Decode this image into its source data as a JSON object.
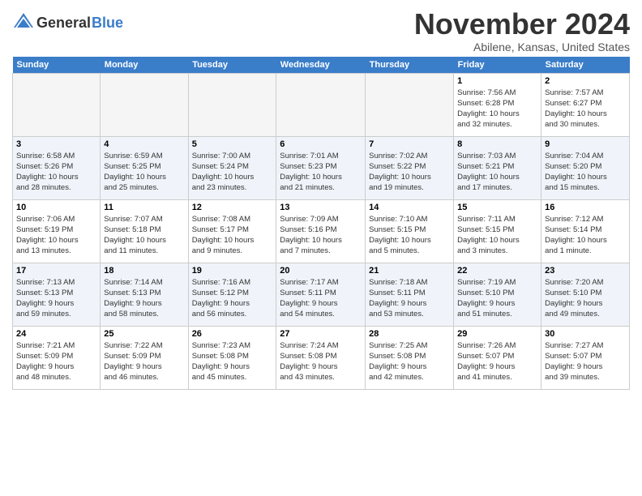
{
  "header": {
    "logo_line1": "General",
    "logo_line2": "Blue",
    "month_title": "November 2024",
    "location": "Abilene, Kansas, United States"
  },
  "calendar": {
    "weekdays": [
      "Sunday",
      "Monday",
      "Tuesday",
      "Wednesday",
      "Thursday",
      "Friday",
      "Saturday"
    ],
    "weeks": [
      [
        {
          "day": "",
          "info": ""
        },
        {
          "day": "",
          "info": ""
        },
        {
          "day": "",
          "info": ""
        },
        {
          "day": "",
          "info": ""
        },
        {
          "day": "",
          "info": ""
        },
        {
          "day": "1",
          "info": "Sunrise: 7:56 AM\nSunset: 6:28 PM\nDaylight: 10 hours\nand 32 minutes."
        },
        {
          "day": "2",
          "info": "Sunrise: 7:57 AM\nSunset: 6:27 PM\nDaylight: 10 hours\nand 30 minutes."
        }
      ],
      [
        {
          "day": "3",
          "info": "Sunrise: 6:58 AM\nSunset: 5:26 PM\nDaylight: 10 hours\nand 28 minutes."
        },
        {
          "day": "4",
          "info": "Sunrise: 6:59 AM\nSunset: 5:25 PM\nDaylight: 10 hours\nand 25 minutes."
        },
        {
          "day": "5",
          "info": "Sunrise: 7:00 AM\nSunset: 5:24 PM\nDaylight: 10 hours\nand 23 minutes."
        },
        {
          "day": "6",
          "info": "Sunrise: 7:01 AM\nSunset: 5:23 PM\nDaylight: 10 hours\nand 21 minutes."
        },
        {
          "day": "7",
          "info": "Sunrise: 7:02 AM\nSunset: 5:22 PM\nDaylight: 10 hours\nand 19 minutes."
        },
        {
          "day": "8",
          "info": "Sunrise: 7:03 AM\nSunset: 5:21 PM\nDaylight: 10 hours\nand 17 minutes."
        },
        {
          "day": "9",
          "info": "Sunrise: 7:04 AM\nSunset: 5:20 PM\nDaylight: 10 hours\nand 15 minutes."
        }
      ],
      [
        {
          "day": "10",
          "info": "Sunrise: 7:06 AM\nSunset: 5:19 PM\nDaylight: 10 hours\nand 13 minutes."
        },
        {
          "day": "11",
          "info": "Sunrise: 7:07 AM\nSunset: 5:18 PM\nDaylight: 10 hours\nand 11 minutes."
        },
        {
          "day": "12",
          "info": "Sunrise: 7:08 AM\nSunset: 5:17 PM\nDaylight: 10 hours\nand 9 minutes."
        },
        {
          "day": "13",
          "info": "Sunrise: 7:09 AM\nSunset: 5:16 PM\nDaylight: 10 hours\nand 7 minutes."
        },
        {
          "day": "14",
          "info": "Sunrise: 7:10 AM\nSunset: 5:15 PM\nDaylight: 10 hours\nand 5 minutes."
        },
        {
          "day": "15",
          "info": "Sunrise: 7:11 AM\nSunset: 5:15 PM\nDaylight: 10 hours\nand 3 minutes."
        },
        {
          "day": "16",
          "info": "Sunrise: 7:12 AM\nSunset: 5:14 PM\nDaylight: 10 hours\nand 1 minute."
        }
      ],
      [
        {
          "day": "17",
          "info": "Sunrise: 7:13 AM\nSunset: 5:13 PM\nDaylight: 9 hours\nand 59 minutes."
        },
        {
          "day": "18",
          "info": "Sunrise: 7:14 AM\nSunset: 5:13 PM\nDaylight: 9 hours\nand 58 minutes."
        },
        {
          "day": "19",
          "info": "Sunrise: 7:16 AM\nSunset: 5:12 PM\nDaylight: 9 hours\nand 56 minutes."
        },
        {
          "day": "20",
          "info": "Sunrise: 7:17 AM\nSunset: 5:11 PM\nDaylight: 9 hours\nand 54 minutes."
        },
        {
          "day": "21",
          "info": "Sunrise: 7:18 AM\nSunset: 5:11 PM\nDaylight: 9 hours\nand 53 minutes."
        },
        {
          "day": "22",
          "info": "Sunrise: 7:19 AM\nSunset: 5:10 PM\nDaylight: 9 hours\nand 51 minutes."
        },
        {
          "day": "23",
          "info": "Sunrise: 7:20 AM\nSunset: 5:10 PM\nDaylight: 9 hours\nand 49 minutes."
        }
      ],
      [
        {
          "day": "24",
          "info": "Sunrise: 7:21 AM\nSunset: 5:09 PM\nDaylight: 9 hours\nand 48 minutes."
        },
        {
          "day": "25",
          "info": "Sunrise: 7:22 AM\nSunset: 5:09 PM\nDaylight: 9 hours\nand 46 minutes."
        },
        {
          "day": "26",
          "info": "Sunrise: 7:23 AM\nSunset: 5:08 PM\nDaylight: 9 hours\nand 45 minutes."
        },
        {
          "day": "27",
          "info": "Sunrise: 7:24 AM\nSunset: 5:08 PM\nDaylight: 9 hours\nand 43 minutes."
        },
        {
          "day": "28",
          "info": "Sunrise: 7:25 AM\nSunset: 5:08 PM\nDaylight: 9 hours\nand 42 minutes."
        },
        {
          "day": "29",
          "info": "Sunrise: 7:26 AM\nSunset: 5:07 PM\nDaylight: 9 hours\nand 41 minutes."
        },
        {
          "day": "30",
          "info": "Sunrise: 7:27 AM\nSunset: 5:07 PM\nDaylight: 9 hours\nand 39 minutes."
        }
      ]
    ]
  }
}
